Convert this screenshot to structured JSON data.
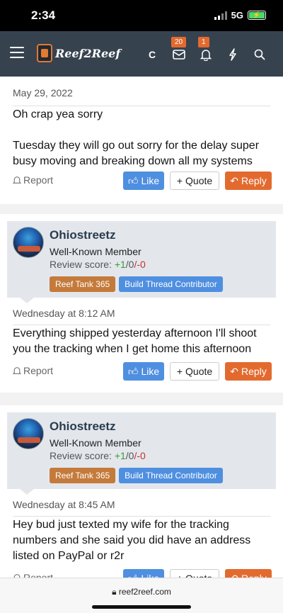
{
  "status": {
    "time": "2:34",
    "network": "5G"
  },
  "nav": {
    "logo_text": "Reef2Reef",
    "c_label": "C",
    "inbox_count": "20",
    "alerts_count": "1"
  },
  "post1": {
    "date": "May 29, 2022",
    "message": [
      "Oh crap yea sorry",
      "Tuesday they will go out sorry for the delay super busy moving and breaking down all my systems"
    ]
  },
  "post2": {
    "username": "Ohiostreetz",
    "user_title": "Well-Known Member",
    "score_label": "Review score:",
    "score_pos": "+1",
    "score_zero": "/0",
    "score_neg": "/-0",
    "banner_a": "Reef Tank 365",
    "banner_b": "Build Thread Contributor",
    "date": "Wednesday at 8:12 AM",
    "message": "Everything shipped yesterday afternoon I'll shoot you the tracking when I get home this afternoon"
  },
  "post3": {
    "username": "Ohiostreetz",
    "user_title": "Well-Known Member",
    "score_label": "Review score:",
    "score_pos": "+1",
    "score_zero": "/0",
    "score_neg": "/-0",
    "banner_a": "Reef Tank 365",
    "banner_b": "Build Thread Contributor",
    "date": "Wednesday at 8:45 AM",
    "message": "Hey bud just texted my wife for the tracking numbers and she said you did have an address listed on PayPal or r2r"
  },
  "actions": {
    "report": "Report",
    "like": "Like",
    "quote": "Quote",
    "reply": "Reply"
  },
  "browser": {
    "url": "reef2reef.com"
  }
}
